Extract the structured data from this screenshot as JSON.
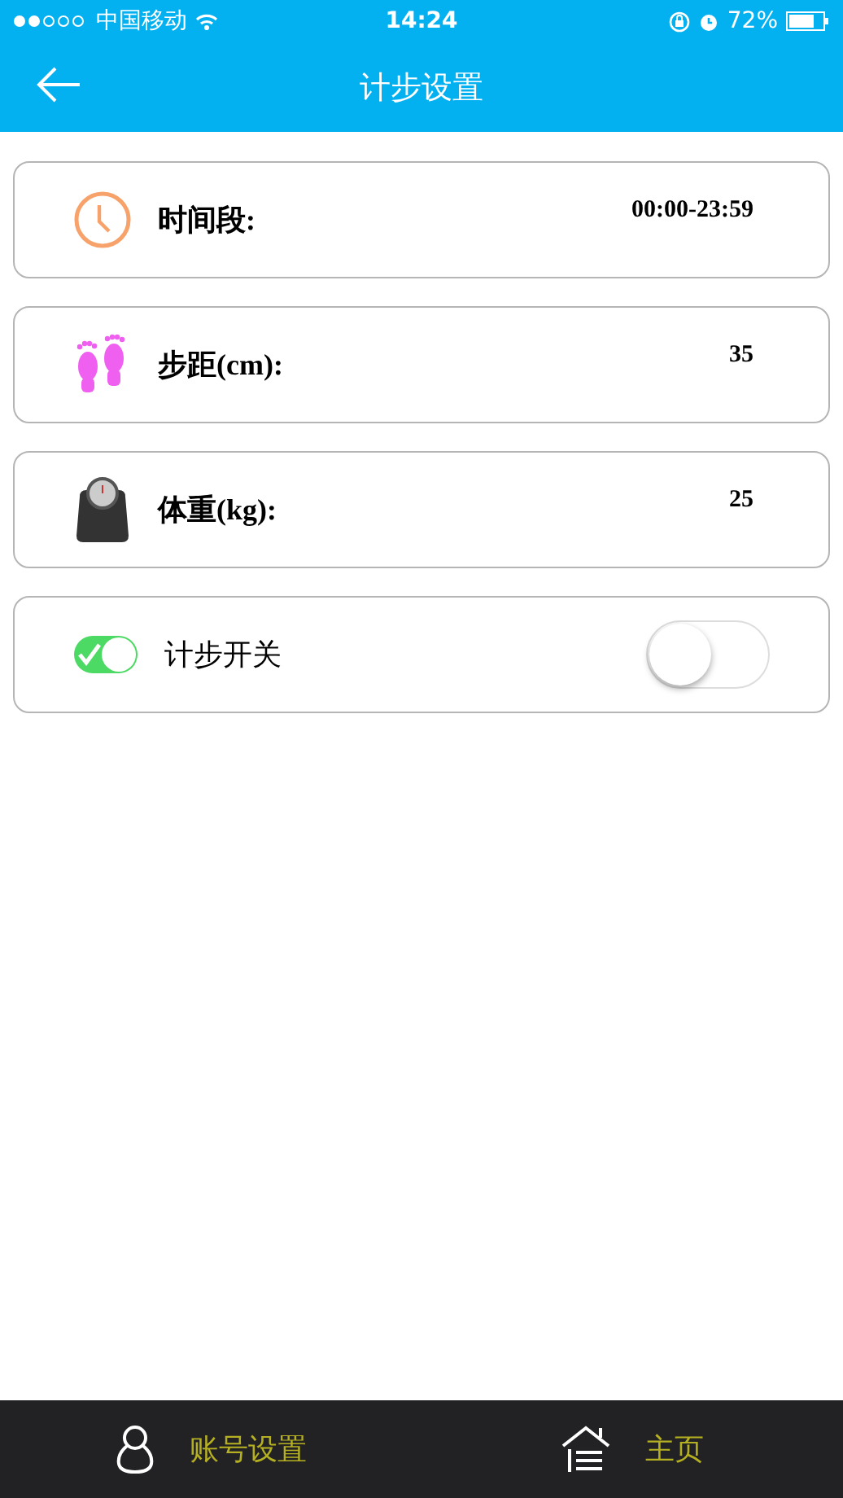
{
  "status_bar": {
    "carrier": "中国移动",
    "time": "14:24",
    "battery": "72%"
  },
  "header": {
    "title": "计步设置"
  },
  "rows": [
    {
      "kind": "value",
      "label": "时间段:",
      "value": "00:00-23:59"
    },
    {
      "kind": "value",
      "label": "步距(cm):",
      "value": "35"
    },
    {
      "kind": "value",
      "label": "体重(kg):",
      "value": "25"
    },
    {
      "kind": "toggle",
      "label": "计步开关",
      "on": false
    }
  ],
  "bottom_nav": [
    {
      "label": "账号设置"
    },
    {
      "label": "主页"
    }
  ]
}
